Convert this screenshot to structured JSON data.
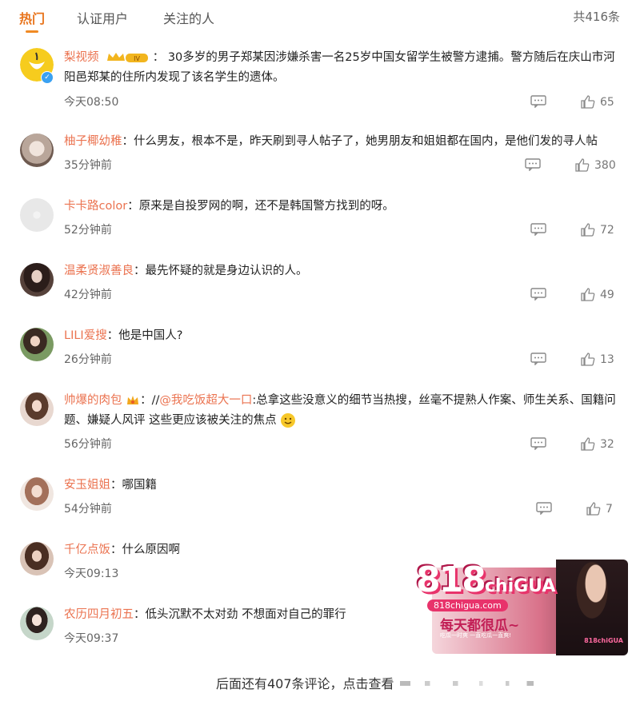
{
  "tabs": [
    {
      "label": "热门",
      "active": true
    },
    {
      "label": "认证用户",
      "active": false
    },
    {
      "label": "关注的人",
      "active": false
    }
  ],
  "total_count": "共416条",
  "comments": [
    {
      "user": "梨视频",
      "separator": "：",
      "text": "30多岁的男子郑某因涉嫌杀害一名25岁中国女留学生被警方逮捕。警方随后在庆山市河阳邑郑某的住所内发现了该名学生的遗体。",
      "time": "今天08:50",
      "likes": "65",
      "level_badge": "IV"
    },
    {
      "user": "柚子椰幼稚",
      "separator": "：",
      "text": "什么男友，根本不是，昨天刷到寻人帖子了，她男朋友和姐姐都在国内，是他们发的寻人帖",
      "time": "35分钟前",
      "likes": "380"
    },
    {
      "user": "卡卡路color",
      "separator": "：",
      "text": "原来是自投罗网的啊，还不是韩国警方找到的呀。",
      "time": "52分钟前",
      "likes": "72"
    },
    {
      "user": "温柔贤淑善良",
      "separator": "：",
      "text": "最先怀疑的就是身边认识的人。",
      "time": "42分钟前",
      "likes": "49"
    },
    {
      "user": "LILI爱搜",
      "separator": "：",
      "text": "他是中国人?",
      "time": "26分钟前",
      "likes": "13"
    },
    {
      "user": "帅爆的肉包",
      "separator": "：",
      "text_prefix": "//",
      "mention": "@我吃饭超大一口",
      "text": ":总拿这些没意义的细节当热搜，丝毫不提熟人作案、师生关系、国籍问题、嫌疑人风评 这些更应该被关注的焦点",
      "time": "56分钟前",
      "likes": "32"
    },
    {
      "user": "安玉姐姐",
      "separator": "：",
      "text": "哪国籍",
      "time": "54分钟前",
      "likes": "7"
    },
    {
      "user": "千亿点饭",
      "separator": "：",
      "text": "什么原因啊",
      "time": "今天09:13"
    },
    {
      "user": "农历四月初五",
      "separator": "：",
      "text": "低头沉默不太对劲 不想面对自己的罪行",
      "time": "今天09:37"
    }
  ],
  "footer": {
    "more_text": "后面还有407条评论，点击查看"
  },
  "watermark": {
    "logo_num": "818",
    "logo_word": "chiGUA",
    "url": "818chigua.com",
    "slogan": "每天都很瓜~",
    "sub": "吃瓜一时爽 一直吃瓜一直爽!",
    "brand": "818chiGUA"
  },
  "colors": {
    "accent": "#e8741c",
    "username": "#eb7350",
    "verified": "#3aa1f2"
  }
}
